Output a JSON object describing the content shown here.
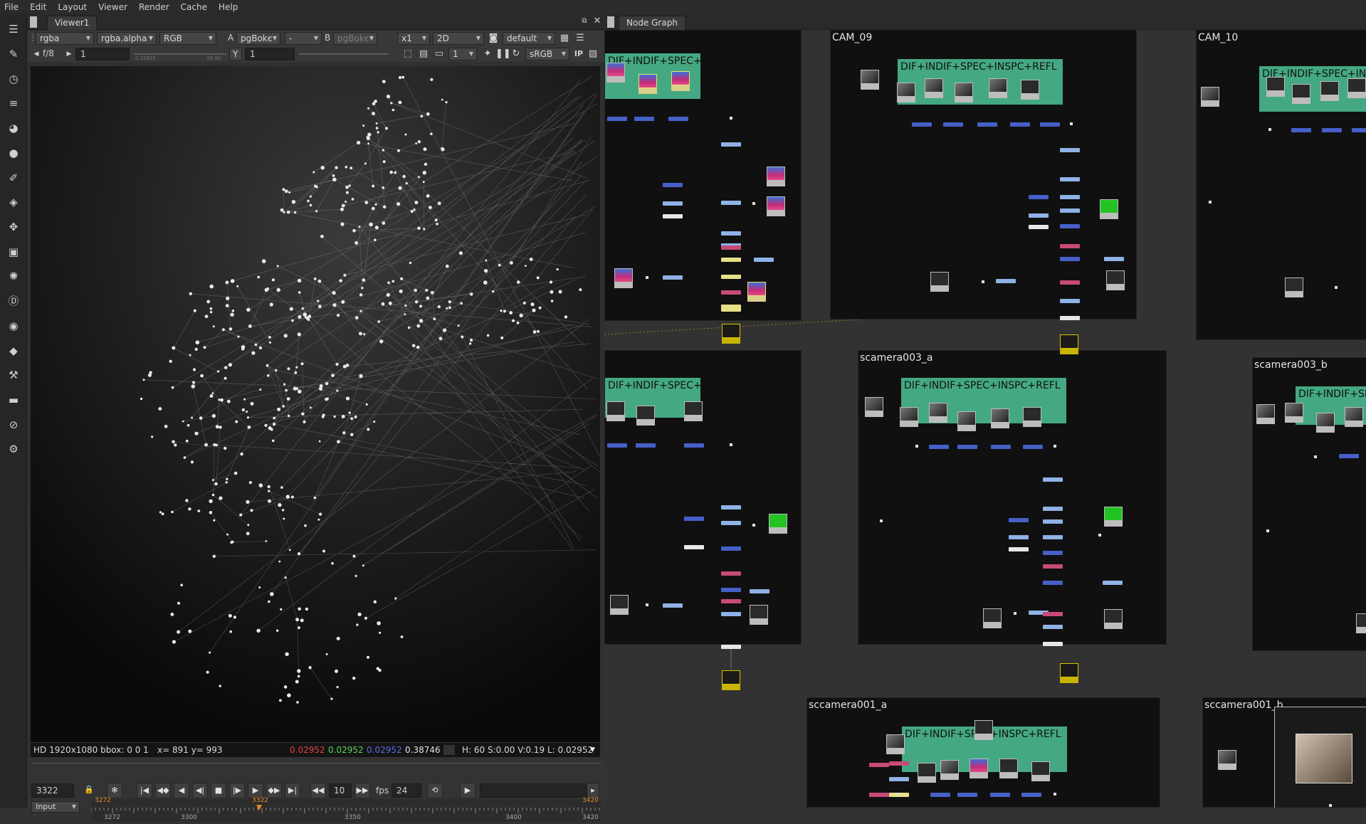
{
  "menu": [
    "File",
    "Edit",
    "Layout",
    "Viewer",
    "Render",
    "Cache",
    "Help"
  ],
  "toolbar_icons": [
    "pin-icon",
    "pen-icon",
    "clock-icon",
    "list-icon",
    "color-icon",
    "circle-icon",
    "brush-icon",
    "layers-icon",
    "move-icon",
    "cube-icon",
    "particles-icon",
    "deep-icon",
    "eye-icon",
    "tag-icon",
    "wrench-icon",
    "box-icon",
    "gizmo-icon",
    "script-icon"
  ],
  "viewer": {
    "tab_label": "Viewer1",
    "row1": {
      "channels": "rgba",
      "alpha": "rgba.alpha",
      "display": "RGB",
      "a_label": "A",
      "a_input": "pgBokє",
      "comp_op": "-",
      "b_label": "B",
      "b_input": "pgBokє",
      "zoom": "x1",
      "mode": "2D",
      "lut": "default"
    },
    "row2": {
      "fstop": "f/8",
      "gain": "1",
      "gain_min": "0.15625",
      "gain_max": "10.00",
      "gamma_label": "Y",
      "gamma": "1",
      "proxy": "1",
      "colorspace": "sRGB",
      "ip": "IP"
    },
    "info": {
      "format": "HD 1920x1080 bbox: 0 0 1",
      "coords": "x= 891 y= 993",
      "r": "0.02952",
      "g": "0.02952",
      "b": "0.02952",
      "a": "0.38746",
      "hsvl": "H: 60 S:0.00 V:0.19  L: 0.02952"
    },
    "timeline": {
      "frame": "3322",
      "skip": "10",
      "fps_label": "fps",
      "fps": "24",
      "input_mode": "Input",
      "in_marker": "3272",
      "cursor": "3322",
      "out_marker": "3420",
      "ticks": [
        "3272",
        "3300",
        "3350",
        "3400",
        "3420"
      ]
    },
    "colors": {
      "red": "#e44242",
      "green": "#58d658",
      "blue": "#5a6be6"
    }
  },
  "nodegraph": {
    "tab_label": "Node Graph",
    "backdrops": [
      {
        "title": "",
        "comp_label": "DIF+INDIF+SPEC+INSPC+REFL"
      },
      {
        "title": "CAM_09",
        "comp_label": "DIF+INDIF+SPEC+INSPC+REFL"
      },
      {
        "title": "CAM_10",
        "comp_label": "DIF+INDIF+SPEC+INSPC+REFL"
      },
      {
        "title": "",
        "comp_label": "DIF+INDIF+SPEC+INSPC+REFL"
      },
      {
        "title": "scamera003_a",
        "comp_label": "DIF+INDIF+SPEC+INSPC+REFL"
      },
      {
        "title": "scamera003_b",
        "comp_label": "DIF+INDIF+SPEC+INSPC+REFL"
      },
      {
        "title": "sccamera001_a",
        "comp_label": "DIF+INDIF+SPEC+INSPC+REFL"
      },
      {
        "title": "sccamera001_b",
        "comp_label": ""
      }
    ],
    "colors": {
      "backdrop": "#101010",
      "comp": "#44a882",
      "merge": "#4660c8",
      "grade": "#8fb2e6",
      "shuffle": "#c84a78",
      "wire": "#e0a33a"
    }
  }
}
